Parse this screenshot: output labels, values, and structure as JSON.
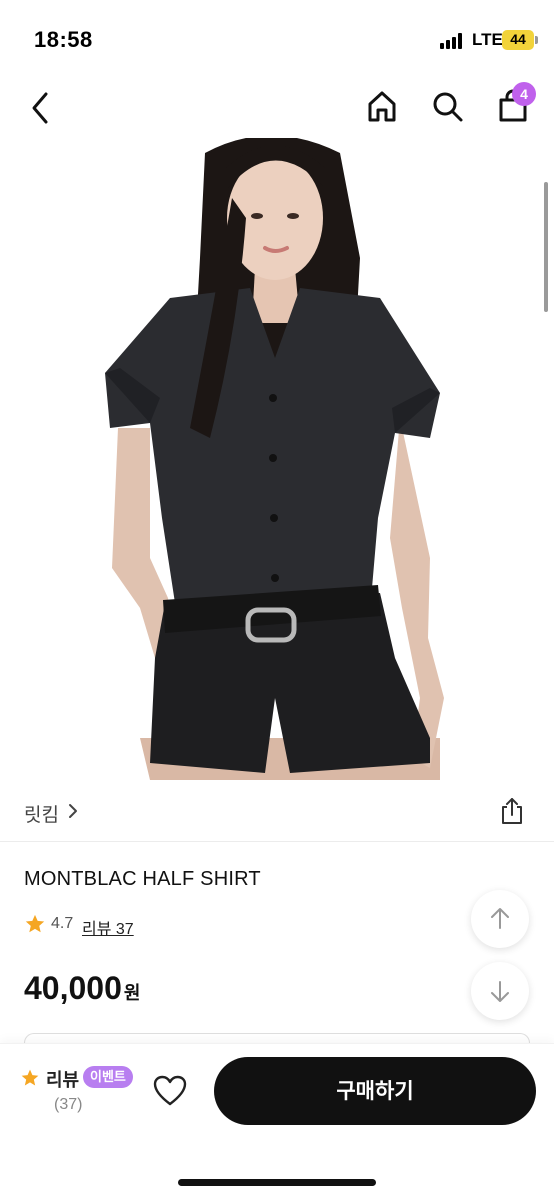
{
  "status_bar": {
    "time": "18:58",
    "network": "LTE",
    "battery": "44"
  },
  "nav": {
    "back_icon": "chevron-left-icon",
    "home_icon": "home-icon",
    "search_icon": "search-icon",
    "cart_icon": "shopping-bag-icon",
    "cart_count": "4"
  },
  "product": {
    "brand": "릿킴",
    "name": "MONTBLAC HALF SHIRT",
    "rating": "4.7",
    "review_link": "리뷰 37",
    "price": "40,000",
    "price_unit": "원"
  },
  "bottom_bar": {
    "review_label": "리뷰",
    "event_badge": "이벤트",
    "review_count": "(37)",
    "buy_label": "구매하기"
  },
  "colors": {
    "accent_purple": "#c061ec",
    "event_purple": "#b87ef0",
    "star_orange": "#f5a623",
    "button_black": "#111111"
  }
}
